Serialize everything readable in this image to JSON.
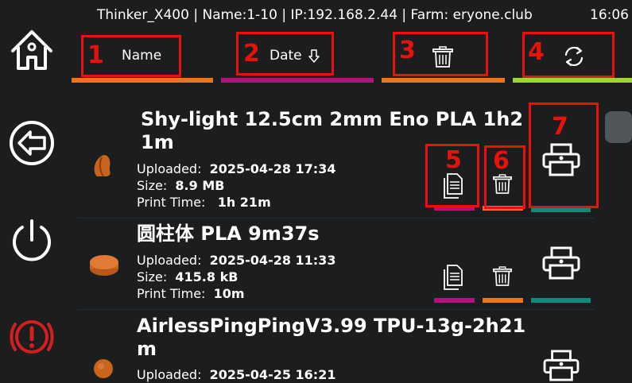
{
  "topbar": {
    "title": "Thinker_X400 | Name:1-10 | IP:192.168.2.44 | Farm: eryone.club",
    "clock": "16:06"
  },
  "sidebar": {
    "home_icon": "home-icon",
    "back_icon": "back-arrow-icon",
    "power_icon": "power-icon",
    "emergency_icon": "emergency-stop-icon"
  },
  "header": {
    "name_label": "Name",
    "date_label": "Date",
    "date_sort_icon": "arrow-down-icon",
    "delete_icon": "trash-icon",
    "refresh_icon": "refresh-icon"
  },
  "annotations": [
    "1",
    "2",
    "3",
    "4",
    "5",
    "6",
    "7"
  ],
  "colors": {
    "orange": "#f07318",
    "magenta": "#b5117d",
    "lime": "#9cd62b",
    "teal": "#13897b",
    "emergency_red": "#d41f1f",
    "annotation_red": "#e8120c"
  },
  "files": [
    {
      "title_line1": "Shy-light 12.5cm 2mm Eno PLA 1h2",
      "title_line2": "1m",
      "uploaded_label": "Uploaded:",
      "uploaded": "2025-04-28 17:34",
      "size_label": "Size:",
      "size": "8.9 MB",
      "print_time_label": "Print Time:",
      "print_time": "1h 21m"
    },
    {
      "title_line1": "圆柱体 PLA 9m37s",
      "uploaded_label": "Uploaded:",
      "uploaded": "2025-04-28 11:33",
      "size_label": "Size:",
      "size": "415.8 kB",
      "print_time_label": "Print Time:",
      "print_time": "10m"
    },
    {
      "title_line1": "AirlessPingPingV3.99 TPU-13g-2h21",
      "title_line2": "m",
      "uploaded_label": "Uploaded:",
      "uploaded": "2025-04-25 16:21"
    }
  ]
}
